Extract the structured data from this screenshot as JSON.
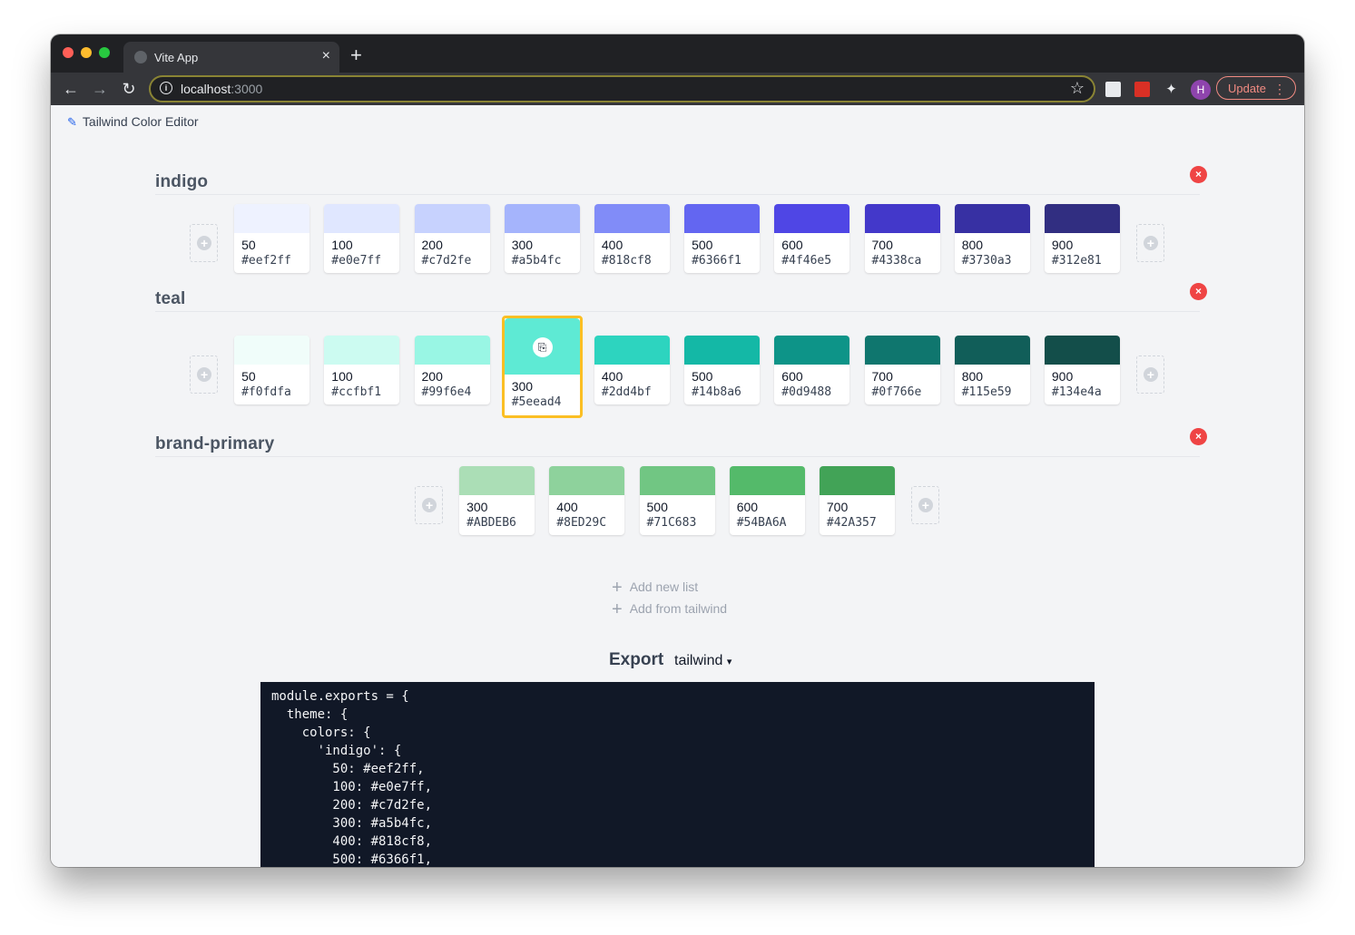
{
  "browser": {
    "tab_title": "Vite App",
    "tab_close": "×",
    "new_tab": "+",
    "url_host": "localhost",
    "url_port": ":3000",
    "avatar_letter": "H",
    "update_label": "Update",
    "update_menu": "⋮"
  },
  "app": {
    "title": "Tailwind Color Editor"
  },
  "palettes": [
    {
      "name": "indigo",
      "swatches": [
        {
          "shade": "50",
          "hex": "#eef2ff"
        },
        {
          "shade": "100",
          "hex": "#e0e7ff"
        },
        {
          "shade": "200",
          "hex": "#c7d2fe"
        },
        {
          "shade": "300",
          "hex": "#a5b4fc"
        },
        {
          "shade": "400",
          "hex": "#818cf8"
        },
        {
          "shade": "500",
          "hex": "#6366f1"
        },
        {
          "shade": "600",
          "hex": "#4f46e5"
        },
        {
          "shade": "700",
          "hex": "#4338ca"
        },
        {
          "shade": "800",
          "hex": "#3730a3"
        },
        {
          "shade": "900",
          "hex": "#312e81"
        }
      ]
    },
    {
      "name": "teal",
      "selected_index": 3,
      "swatches": [
        {
          "shade": "50",
          "hex": "#f0fdfa"
        },
        {
          "shade": "100",
          "hex": "#ccfbf1"
        },
        {
          "shade": "200",
          "hex": "#99f6e4"
        },
        {
          "shade": "300",
          "hex": "#5eead4"
        },
        {
          "shade": "400",
          "hex": "#2dd4bf"
        },
        {
          "shade": "500",
          "hex": "#14b8a6"
        },
        {
          "shade": "600",
          "hex": "#0d9488"
        },
        {
          "shade": "700",
          "hex": "#0f766e"
        },
        {
          "shade": "800",
          "hex": "#115e59"
        },
        {
          "shade": "900",
          "hex": "#134e4a"
        }
      ]
    },
    {
      "name": "brand-primary",
      "swatches": [
        {
          "shade": "300",
          "hex": "#ABDEB6"
        },
        {
          "shade": "400",
          "hex": "#8ED29C"
        },
        {
          "shade": "500",
          "hex": "#71C683"
        },
        {
          "shade": "600",
          "hex": "#54BA6A"
        },
        {
          "shade": "700",
          "hex": "#42A357"
        }
      ]
    }
  ],
  "actions": {
    "add_list": "Add new list",
    "add_tailwind": "Add from tailwind"
  },
  "export": {
    "label": "Export",
    "format": "tailwind",
    "code": "module.exports = {\n  theme: {\n    colors: {\n      'indigo': {\n        50: #eef2ff,\n        100: #e0e7ff,\n        200: #c7d2fe,\n        300: #a5b4fc,\n        400: #818cf8,\n        500: #6366f1,"
  },
  "colors": {
    "accent": "#2563eb",
    "remove": "#ef4444",
    "selected_border": "#fbbf24"
  }
}
